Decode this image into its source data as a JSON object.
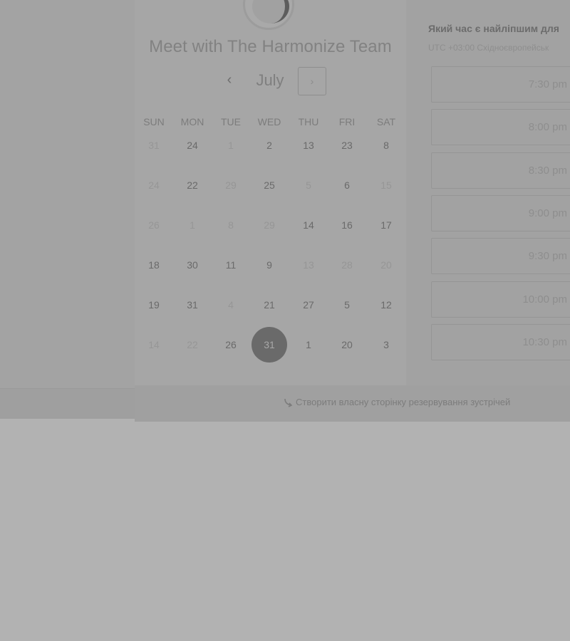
{
  "booking": {
    "title": "Meet with The Harmonize Team",
    "month": "July",
    "prev_glyph": "‹",
    "next_glyph": "›",
    "weekdays": [
      "SUN",
      "MON",
      "TUE",
      "WED",
      "THU",
      "FRI",
      "SAT"
    ],
    "weeks": [
      [
        "31",
        "24",
        "1",
        "2",
        "13",
        "23",
        "8"
      ],
      [
        "24",
        "22",
        "29",
        "25",
        "5",
        "6",
        "15"
      ],
      [
        "26",
        "1",
        "8",
        "29",
        "14",
        "16",
        "17"
      ],
      [
        "18",
        "30",
        "11",
        "9",
        "13",
        "28",
        "20"
      ],
      [
        "19",
        "31",
        "4",
        "21",
        "27",
        "5",
        "12"
      ],
      [
        "14",
        "22",
        "26",
        "31",
        "1",
        "20",
        "3"
      ]
    ],
    "dim_days": [
      "0-0",
      "0-2",
      "1-0",
      "1-2",
      "1-4",
      "1-6",
      "2-0",
      "2-1",
      "2-2",
      "2-3",
      "3-4",
      "3-5",
      "3-6",
      "4-2",
      "5-0",
      "5-1"
    ],
    "selected_day": "5-3"
  },
  "times": {
    "question": "Який час є найліпшим для",
    "timezone": "UTC +03:00 Східноєвропейськ",
    "slots": [
      "7:30 pm",
      "8:00 pm",
      "8:30 pm",
      "9:00 pm",
      "9:30 pm",
      "10:00 pm",
      "10:30 pm"
    ]
  },
  "footer": {
    "link_label": "Створити власну сторінку резервування зустрічей"
  }
}
